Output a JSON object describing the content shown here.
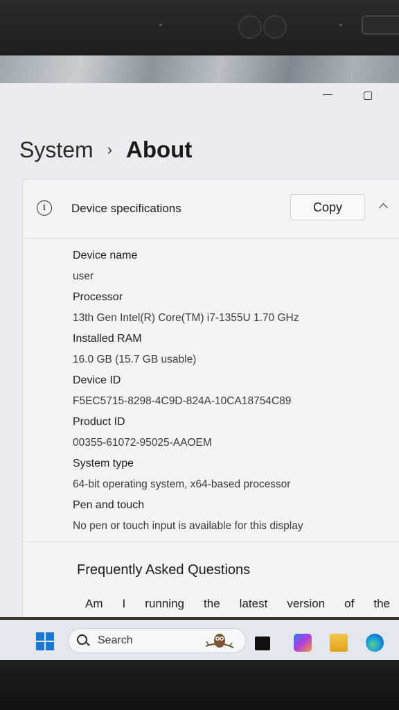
{
  "breadcrumb": {
    "parent": "System",
    "separator": "›",
    "current": "About"
  },
  "device_specs": {
    "header_title": "Device specifications",
    "copy_label": "Copy",
    "items": [
      {
        "label": "Device name",
        "value": "user"
      },
      {
        "label": "Processor",
        "value": "13th Gen Intel(R) Core(TM) i7-1355U   1.70 GHz"
      },
      {
        "label": "Installed RAM",
        "value": "16.0 GB (15.7 GB usable)"
      },
      {
        "label": "Device ID",
        "value": "F5EC5715-8298-4C9D-824A-10CA18754C89"
      },
      {
        "label": "Product ID",
        "value": "00355-61072-95025-AAOEM"
      },
      {
        "label": "System type",
        "value": "64-bit operating system, x64-based processor"
      },
      {
        "label": "Pen and touch",
        "value": "No pen or touch input is available for this display"
      }
    ]
  },
  "faq": {
    "title": "Frequently Asked Questions",
    "first_question": "Am I running the latest version of the"
  },
  "taskbar": {
    "search_placeholder": "Search",
    "accent_color": "#1a78d6"
  }
}
